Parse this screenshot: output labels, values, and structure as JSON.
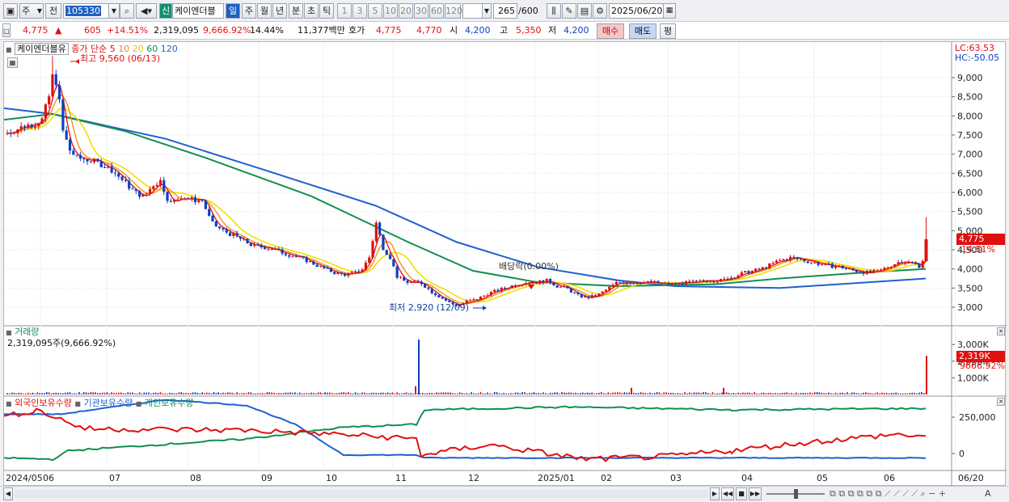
{
  "toolbar": {
    "market_label": "주",
    "type_label": "전",
    "code_value": "105330",
    "sin_badge": "신",
    "stock_name": "케이엔더블",
    "period_tabs": [
      "일",
      "주",
      "월",
      "년",
      "분",
      "초",
      "틱"
    ],
    "active_period": "일",
    "intervals": [
      "1",
      "3",
      "5",
      "10",
      "20",
      "30",
      "60",
      "120"
    ],
    "count_value": "265",
    "count_total": "/600",
    "date_value": "2025/06/20",
    "icons": [
      "chart-type-icon",
      "search-icon",
      "speaker-icon",
      "candle-icon",
      "draw-icon",
      "save-icon",
      "gear-icon",
      "calendar-icon"
    ]
  },
  "quote": {
    "price": "4,775",
    "change_arrow": "▲",
    "change": "605",
    "change_pct": "+14.51%",
    "volume": "2,319,095",
    "volume_ratio": "9,666.92%",
    "turnover": "14.44%",
    "amount": "11,377백만",
    "hoga_label": "호가",
    "ask": "4,775",
    "bid": "4,770",
    "open_label": "시",
    "open": "4,200",
    "high_label": "고",
    "high": "5,350",
    "low_label": "저",
    "low": "4,200",
    "buy_label": "매수",
    "sell_label": "매도",
    "eval_label": "평"
  },
  "price_panel": {
    "title": "케이엔더블유",
    "legend_prefix": "종가 단순",
    "ma": [
      {
        "label": "5",
        "color": "#e01010"
      },
      {
        "label": "10",
        "color": "#f08c10"
      },
      {
        "label": "20",
        "color": "#f0e000"
      },
      {
        "label": "60",
        "color": "#119050"
      },
      {
        "label": "120",
        "color": "#2060d0"
      }
    ],
    "max_label": "최고 9,560 (06/13)",
    "min_label": "최저 2,920 (12/09)",
    "dividend_label": "배당락(0.00%)",
    "lc": "LC:63.53",
    "hc": "HC:-50.05",
    "price_tag": "4,775",
    "pct_tag": "14.51%",
    "y_ticks": [
      "9,000",
      "8,500",
      "8,000",
      "7,500",
      "7,000",
      "6,500",
      "6,000",
      "5,500",
      "5,000",
      "4,500",
      "4,000",
      "3,500",
      "3,000"
    ]
  },
  "volume_panel": {
    "title": "거래량",
    "value": "2,319,095주(9,666.92%)",
    "y_ticks": [
      "3,000K",
      "2,000K",
      "1,000K"
    ],
    "tag": "2,319K",
    "tag_pct": "9666.92%"
  },
  "holder_panel": {
    "legend": [
      {
        "label": "외국인보유수량",
        "color": "#e01010"
      },
      {
        "label": "기관보유수량",
        "color": "#2060d0"
      },
      {
        "label": "개인보유수량",
        "color": "#119050"
      }
    ],
    "y_ticks": [
      "250,000",
      "0"
    ]
  },
  "x_axis": [
    "2024/05",
    "06",
    "07",
    "08",
    "09",
    "10",
    "11",
    "12",
    "2025/01",
    "02",
    "03",
    "04",
    "05",
    "06",
    "06/20"
  ],
  "chart_data": {
    "type": "candlestick",
    "title": "케이엔더블유",
    "ylim": [
      2700,
      9700
    ],
    "series_summary": {
      "max": {
        "value": 9560,
        "date": "06/13"
      },
      "min": {
        "value": 2920,
        "date": "12/09"
      },
      "last_close": 4775,
      "last_open": 4200,
      "last_high": 5350,
      "last_low": 4200
    },
    "close_path": [
      [
        0,
        7550
      ],
      [
        8,
        7650
      ],
      [
        16,
        7750
      ],
      [
        24,
        7800
      ],
      [
        30,
        7900
      ],
      [
        36,
        8500
      ],
      [
        40,
        9200
      ],
      [
        44,
        8600
      ],
      [
        48,
        7600
      ],
      [
        54,
        7100
      ],
      [
        60,
        6900
      ],
      [
        70,
        6850
      ],
      [
        80,
        6750
      ],
      [
        90,
        6600
      ],
      [
        100,
        6300
      ],
      [
        110,
        6000
      ],
      [
        118,
        5900
      ],
      [
        126,
        6200
      ],
      [
        132,
        6300
      ],
      [
        140,
        5700
      ],
      [
        150,
        5900
      ],
      [
        160,
        5800
      ],
      [
        168,
        5800
      ],
      [
        176,
        5200
      ],
      [
        186,
        5000
      ],
      [
        200,
        4800
      ],
      [
        212,
        4600
      ],
      [
        226,
        4550
      ],
      [
        240,
        4400
      ],
      [
        256,
        4250
      ],
      [
        270,
        4050
      ],
      [
        282,
        3900
      ],
      [
        290,
        3850
      ],
      [
        300,
        3900
      ],
      [
        306,
        4000
      ],
      [
        312,
        4300
      ],
      [
        318,
        5200
      ],
      [
        324,
        4550
      ],
      [
        330,
        4300
      ],
      [
        336,
        3800
      ],
      [
        344,
        3650
      ],
      [
        356,
        3650
      ],
      [
        366,
        3400
      ],
      [
        374,
        3250
      ],
      [
        382,
        3100
      ],
      [
        388,
        3050
      ],
      [
        396,
        3150
      ],
      [
        404,
        3200
      ],
      [
        414,
        3350
      ],
      [
        424,
        3450
      ],
      [
        434,
        3550
      ],
      [
        446,
        3650
      ],
      [
        456,
        3650
      ],
      [
        466,
        3700
      ],
      [
        474,
        3550
      ],
      [
        482,
        3500
      ],
      [
        492,
        3300
      ],
      [
        500,
        3250
      ],
      [
        508,
        3300
      ],
      [
        516,
        3450
      ],
      [
        526,
        3650
      ],
      [
        540,
        3650
      ],
      [
        556,
        3650
      ],
      [
        570,
        3600
      ],
      [
        590,
        3650
      ],
      [
        604,
        3700
      ],
      [
        616,
        3700
      ],
      [
        626,
        3800
      ],
      [
        636,
        3900
      ],
      [
        650,
        4000
      ],
      [
        664,
        4200
      ],
      [
        676,
        4300
      ],
      [
        690,
        4200
      ],
      [
        704,
        4100
      ],
      [
        718,
        4050
      ],
      [
        730,
        3950
      ],
      [
        742,
        3900
      ],
      [
        752,
        3950
      ],
      [
        762,
        4100
      ],
      [
        770,
        4200
      ],
      [
        780,
        4150
      ],
      [
        788,
        4050
      ],
      [
        792,
        4775
      ]
    ],
    "ma120_path": [
      [
        0,
        8200
      ],
      [
        60,
        8050
      ],
      [
        200,
        7400
      ],
      [
        320,
        6600
      ],
      [
        460,
        5650
      ],
      [
        560,
        4700
      ],
      [
        660,
        4050
      ],
      [
        760,
        3700
      ],
      [
        830,
        3550
      ],
      [
        960,
        3500
      ],
      [
        1140,
        3750
      ]
    ],
    "ma60_path": [
      [
        0,
        7900
      ],
      [
        60,
        8050
      ],
      [
        150,
        7600
      ],
      [
        250,
        6900
      ],
      [
        380,
        5900
      ],
      [
        500,
        4700
      ],
      [
        580,
        3950
      ],
      [
        660,
        3650
      ],
      [
        760,
        3550
      ],
      [
        880,
        3600
      ],
      [
        960,
        3750
      ],
      [
        1060,
        3900
      ],
      [
        1140,
        4000
      ]
    ],
    "volume_spikes": [
      [
        513,
        3300000
      ],
      [
        509,
        500000
      ],
      [
        776,
        400000
      ],
      [
        890,
        400000
      ],
      [
        1141,
        2319095
      ]
    ],
    "holders": {
      "foreign": [
        [
          0,
          250000
        ],
        [
          40,
          300000
        ],
        [
          100,
          170000
        ],
        [
          300,
          160000
        ],
        [
          420,
          130000
        ],
        [
          510,
          100000
        ],
        [
          516,
          -10000
        ],
        [
          600,
          60000
        ],
        [
          720,
          -40000
        ],
        [
          820,
          -20000
        ],
        [
          900,
          20000
        ],
        [
          1000,
          80000
        ],
        [
          1100,
          130000
        ],
        [
          1140,
          120000
        ]
      ],
      "institution": [
        [
          0,
          270000
        ],
        [
          70,
          270000
        ],
        [
          200,
          370000
        ],
        [
          300,
          330000
        ],
        [
          360,
          200000
        ],
        [
          420,
          -10000
        ],
        [
          510,
          -10000
        ],
        [
          520,
          -30000
        ],
        [
          760,
          -30000
        ],
        [
          1140,
          -30000
        ]
      ],
      "individual": [
        [
          0,
          -30000
        ],
        [
          60,
          -40000
        ],
        [
          80,
          20000
        ],
        [
          300,
          100000
        ],
        [
          420,
          180000
        ],
        [
          510,
          200000
        ],
        [
          520,
          300000
        ],
        [
          700,
          320000
        ],
        [
          900,
          300000
        ],
        [
          1140,
          310000
        ]
      ]
    }
  }
}
